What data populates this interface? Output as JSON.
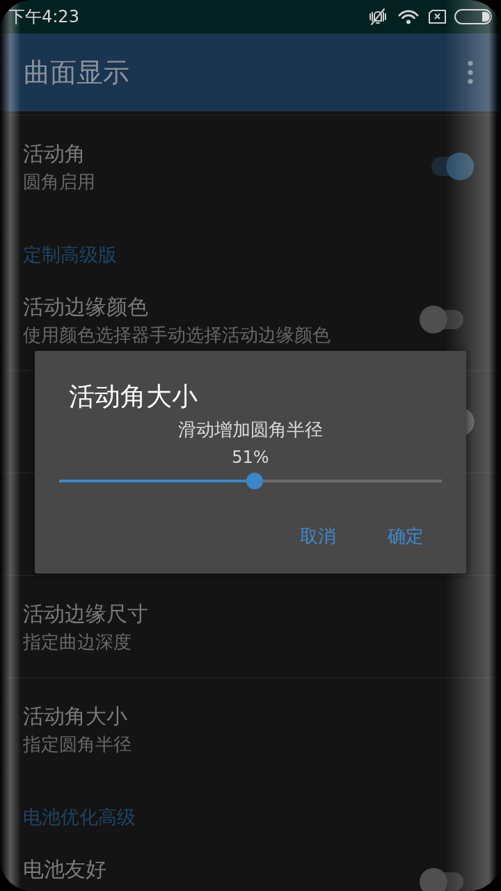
{
  "status_bar": {
    "time": "下午4:23"
  },
  "app_bar": {
    "title": "曲面显示"
  },
  "list": [
    {
      "kind": "setting",
      "title": "活动角",
      "subtitle": "圆角启用",
      "switch": {
        "on": true,
        "disabled": false
      }
    },
    {
      "kind": "section",
      "title": "定制高级版"
    },
    {
      "kind": "setting",
      "title": "活动边缘颜色",
      "subtitle": "使用颜色选择器手动选择活动边缘颜色",
      "switch": {
        "on": false,
        "disabled": false
      }
    },
    {
      "kind": "setting",
      "switch": {
        "on": true,
        "disabled": true
      }
    },
    {
      "kind": "setting"
    },
    {
      "kind": "setting",
      "title": "活动边缘尺寸",
      "subtitle": "指定曲边深度"
    },
    {
      "kind": "setting",
      "title": "活动角大小",
      "subtitle": "指定圆角半径"
    },
    {
      "kind": "section",
      "title": "电池优化高级"
    },
    {
      "kind": "setting",
      "title": "电池友好",
      "switch": {
        "on": false,
        "disabled": false
      }
    }
  ],
  "dialog": {
    "title": "活动角大小",
    "message": "滑动增加圆角半径",
    "value": "51%",
    "slider": {
      "level": 0.51
    },
    "buttons": [
      "取消",
      "确定"
    ]
  }
}
